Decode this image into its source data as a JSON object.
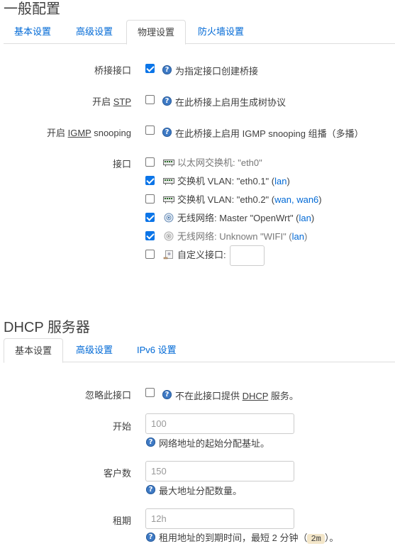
{
  "general": {
    "title": "一般配置",
    "tabs": [
      "基本设置",
      "高级设置",
      "物理设置",
      "防火墙设置"
    ],
    "bridge": {
      "label": "桥接接口",
      "desc": "为指定接口创建桥接"
    },
    "stp": {
      "label_prefix": "开启 ",
      "abbr": "STP",
      "desc": "在此桥接上启用生成树协议"
    },
    "igmp": {
      "label_prefix": "开启 ",
      "abbr": "IGMP",
      "label_suffix": " snooping",
      "desc": "在此桥接上启用 IGMP snooping 组播（多播）"
    },
    "interfaces": {
      "label": "接口",
      "items": [
        {
          "text": "以太网交换机: \"eth0\"",
          "links": ""
        },
        {
          "text": "交换机 VLAN: \"eth0.1\" (",
          "links": "lan",
          "close": ")"
        },
        {
          "text": "交换机 VLAN: \"eth0.2\" (",
          "links": "wan, wan6",
          "close": ")"
        },
        {
          "text": "无线网络: Master \"OpenWrt\" (",
          "links": "lan",
          "close": ")"
        },
        {
          "text": "无线网络: Unknown \"WIFI\" (",
          "links": "lan",
          "close": ")"
        },
        {
          "text": "自定义接口:",
          "links": ""
        }
      ]
    }
  },
  "dhcp": {
    "title": "DHCP 服务器",
    "tabs": [
      "基本设置",
      "高级设置",
      "IPv6 设置"
    ],
    "ignore": {
      "label": "忽略此接口",
      "desc_prefix": "不在此接口提供 ",
      "abbr": "DHCP",
      "desc_suffix": " 服务。"
    },
    "start": {
      "label": "开始",
      "placeholder": "100",
      "desc": "网络地址的起始分配基址。"
    },
    "limit": {
      "label": "客户数",
      "placeholder": "150",
      "desc": "最大地址分配数量。"
    },
    "lease": {
      "label": "租期",
      "placeholder": "12h",
      "desc_prefix": "租用地址的到期时间，最短 2 分钟（",
      "code": "2m",
      "desc_suffix": "）。"
    }
  },
  "icons": {
    "help": "help-icon",
    "switch": "switch-icon",
    "wifi": "wifi-icon",
    "custom": "custom-interface-icon"
  }
}
